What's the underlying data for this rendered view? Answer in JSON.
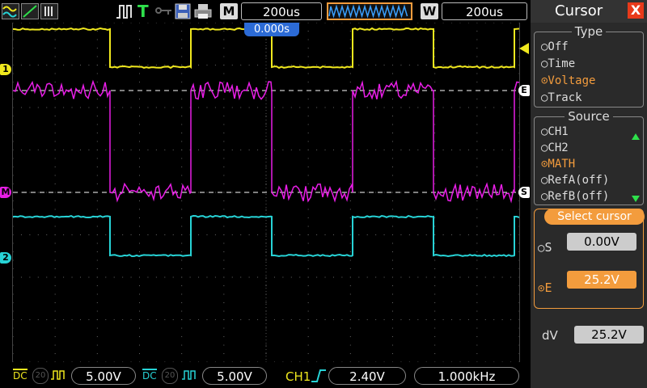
{
  "topbar": {
    "trigger_mode": "T",
    "m_label": "M",
    "timebase": "200us",
    "w_label": "W",
    "window_timebase": "200us",
    "trigger_offset": "0.000s"
  },
  "markers": {
    "ch1": "1",
    "ch2": "2",
    "math": "M",
    "cursor_e": "E",
    "cursor_s": "S"
  },
  "bottombar": {
    "ch1_coupling": "DC",
    "ch1_bw": "20",
    "ch1_scale": "5.00V",
    "ch2_coupling": "DC",
    "ch2_bw": "20",
    "ch2_scale": "5.00V",
    "trigger_source": "CH1",
    "trigger_level": "2.40V",
    "frequency": "1.000kHz"
  },
  "panel": {
    "title": "Cursor",
    "close": "X",
    "type_title": "Type",
    "type_options": [
      "Off",
      "Time",
      "Voltage",
      "Track"
    ],
    "type_selected": 2,
    "source_title": "Source",
    "source_options": [
      "CH1",
      "CH2",
      "MATH",
      "RefA(off)",
      "RefB(off)"
    ],
    "source_selected": 2,
    "select_title": "Select cursor",
    "s_label": "S",
    "s_value": "0.00V",
    "e_label": "E",
    "e_value": "25.2V",
    "dv_label": "dV",
    "dv_value": "25.2V"
  },
  "colors": {
    "ch1": "#f0e81e",
    "ch2": "#27d3d6",
    "math": "#e81ee6",
    "accent": "#f39c3d",
    "grid": "#666666"
  }
}
